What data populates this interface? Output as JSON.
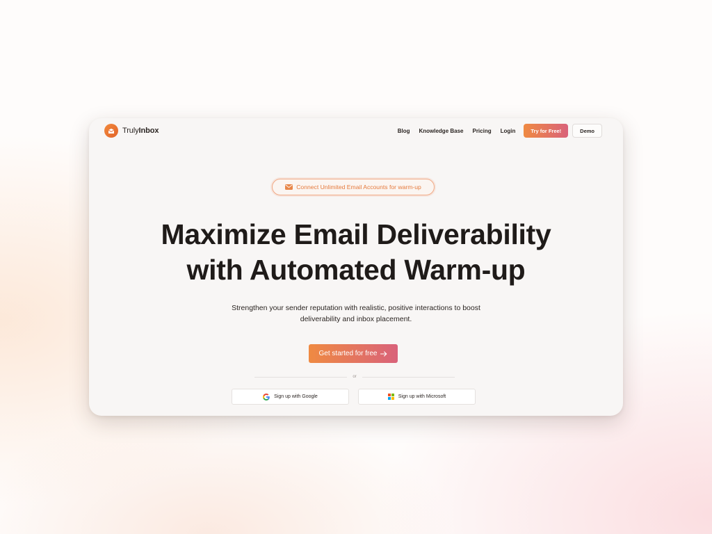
{
  "brand": {
    "name_light": "Truly",
    "name_bold": "Inbox",
    "accent": "#ef8a42",
    "accent_end": "#d9627a"
  },
  "nav": {
    "links": [
      "Blog",
      "Knowledge Base",
      "Pricing",
      "Login"
    ],
    "try_button": "Try for Free!",
    "demo_button": "Demo"
  },
  "hero": {
    "pill_icon": "mail-icon",
    "pill_text": "Connect Unlimited Email Accounts for warm-up",
    "headline_line1": "Maximize Email Deliverability",
    "headline_line2": "with Automated Warm-up",
    "subtext_line1": "Strengthen your sender reputation with realistic, positive interactions to boost",
    "subtext_line2": "deliverability and inbox placement.",
    "cta_label": "Get started for free",
    "cta_icon": "arrow-right-icon",
    "divider_text": "or"
  },
  "signup": {
    "google_label": "Sign up with Google",
    "google_icon": "google-icon",
    "microsoft_label": "Sign up with Microsoft",
    "microsoft_icon": "microsoft-icon"
  }
}
